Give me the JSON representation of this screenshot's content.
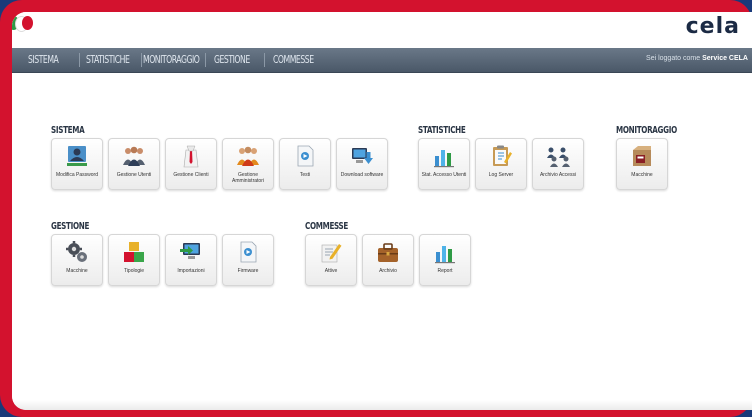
{
  "header": {
    "logo_text": "cela",
    "logo_sub": "",
    "user_prefix": "Sei loggato come ",
    "user_name": "Service CELA"
  },
  "nav": {
    "items": [
      {
        "label": "SISTEMA"
      },
      {
        "label": "STATISTICHE"
      },
      {
        "label": "MONITORAGGIO"
      },
      {
        "label": "GESTIONE"
      },
      {
        "label": "COMMESSE"
      }
    ]
  },
  "sections": {
    "sistema": {
      "title": "SISTEMA",
      "tiles": [
        {
          "label": "Modifica Password",
          "icon": "user-password-icon"
        },
        {
          "label": "Gestione Utenti",
          "icon": "users-group-icon"
        },
        {
          "label": "Gestione Clienti",
          "icon": "client-icon"
        },
        {
          "label": "Gestione Amministratori",
          "icon": "admins-icon"
        },
        {
          "label": "Testi",
          "icon": "text-document-icon"
        },
        {
          "label": "Download software",
          "icon": "download-software-icon"
        }
      ]
    },
    "statistiche": {
      "title": "STATISTICHE",
      "tiles": [
        {
          "label": "Stat. Accesso Utenti",
          "icon": "bar-chart-icon"
        },
        {
          "label": "Log Server",
          "icon": "clipboard-log-icon"
        },
        {
          "label": "Archivio Accessi",
          "icon": "access-archive-icon"
        }
      ]
    },
    "monitoraggio": {
      "title": "MONITORAGGIO",
      "tiles": [
        {
          "label": "Macchine",
          "icon": "machine-box-icon"
        }
      ]
    },
    "gestione": {
      "title": "GESTIONE",
      "tiles": [
        {
          "label": "Macchine",
          "icon": "gears-icon"
        },
        {
          "label": "Tipologie",
          "icon": "cubes-icon"
        },
        {
          "label": "Importazioni",
          "icon": "import-monitor-icon"
        },
        {
          "label": "Firmware",
          "icon": "firmware-document-icon"
        }
      ]
    },
    "commesse": {
      "title": "COMMESSE",
      "tiles": [
        {
          "label": "Attive",
          "icon": "edit-pencil-icon"
        },
        {
          "label": "Archivio",
          "icon": "briefcase-icon"
        },
        {
          "label": "Report",
          "icon": "report-chart-icon"
        }
      ]
    }
  },
  "colors": {
    "frame": "#d3122e",
    "navbar": "#5a6878",
    "title_text": "#2a3544"
  }
}
